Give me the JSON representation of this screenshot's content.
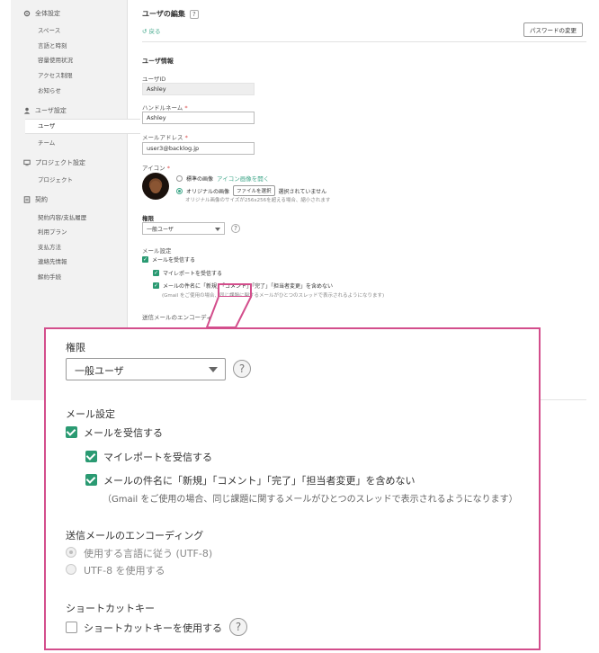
{
  "sidebar": {
    "groups": [
      {
        "label": "全体設定",
        "icon": "gear-icon",
        "items": [
          "スペース",
          "言語と時刻",
          "容量使用状況",
          "アクセス制限",
          "お知らせ"
        ]
      },
      {
        "label": "ユーザ設定",
        "icon": "user-icon",
        "items": [
          "ユーザ",
          "チーム"
        ],
        "active": "ユーザ"
      },
      {
        "label": "プロジェクト設定",
        "icon": "monitor-icon",
        "items": [
          "プロジェクト"
        ]
      },
      {
        "label": "契約",
        "icon": "contract-icon",
        "items": [
          "契約内容/支払履歴",
          "利用プラン",
          "支払方法",
          "連絡先情報",
          "解約手続"
        ]
      }
    ]
  },
  "main": {
    "title": "ユーザの編集",
    "help": "?",
    "back": "戻る",
    "password_button": "パスワードの変更",
    "section": "ユーザ情報",
    "user_id_label": "ユーザID",
    "user_id_value": "Ashley",
    "handle_label": "ハンドルネーム",
    "handle_value": "Ashley",
    "email_label": "メールアドレス",
    "email_value": "user3@backlog.jp",
    "required": "*",
    "icon_label": "アイコン",
    "icon_option1": "標準の画像",
    "icon_option1_link": "アイコン画像を開く",
    "icon_option2": "オリジナルの画像",
    "file_button": "ファイルを選択",
    "file_status": "選択されていません",
    "icon_note": "オリジナル画像のサイズが256x256を超える場合、縮小されます",
    "role_label": "権限",
    "role_value": "一般ユーザ",
    "mail_label": "メール設定",
    "mail_receive": "メールを受信する",
    "mail_report": "マイレポートを受信する",
    "mail_subject": "メールの件名に「新規」「コメント」「完了」「担当者変更」を含めない",
    "mail_note": "(Gmail をご使用の場合、同じ課題に関するメールがひとつのスレッドで表示されるようになります)",
    "encoding_label": "送信メールのエンコーディング"
  },
  "zoom": {
    "role_label": "権限",
    "role_value": "一般ユーザ",
    "help": "?",
    "mail_label": "メール設定",
    "mail_receive": "メールを受信する",
    "mail_report": "マイレポートを受信する",
    "mail_subject": "メールの件名に「新規」「コメント」「完了」「担当者変更」を含めない",
    "mail_note": "（Gmail をご使用の場合、同じ課題に関するメールがひとつのスレッドで表示されるようになります）",
    "encoding_label": "送信メールのエンコーディング",
    "encoding_option1": "使用する言語に従う (UTF-8)",
    "encoding_option2": "UTF-8 を使用する",
    "shortcut_label": "ショートカットキー",
    "shortcut_option": "ショートカットキーを使用する"
  },
  "colors": {
    "accent": "#2a9a72",
    "callout_border": "#d34e8c",
    "link": "#42a88b"
  }
}
